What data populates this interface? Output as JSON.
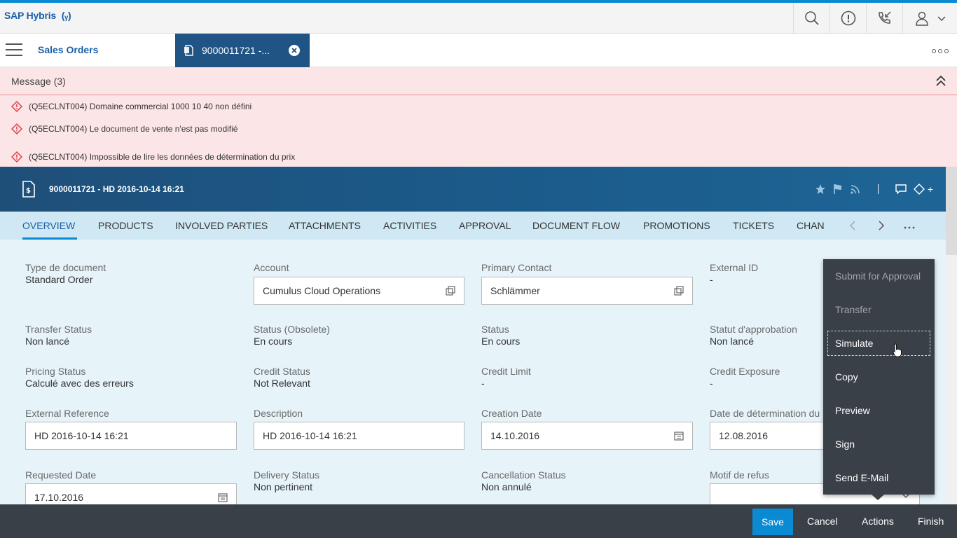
{
  "shell": {
    "logo_text": "SAP Hybris",
    "logo_mark": "(ᵧ)"
  },
  "tabs": {
    "sales_orders": "Sales Orders",
    "document_tab": "9000011721 -..."
  },
  "messages": {
    "header": "Message (3)",
    "items": [
      "(Q5ECLNT004) Domaine commercial 1000 10 40 non défini",
      "(Q5ECLNT004) Le document de vente n'est pas modifié",
      "(Q5ECLNT004) Impossible de lire les données de détermination du prix"
    ]
  },
  "object_header": {
    "title": "9000011721 - HD 2016-10-14 16:21",
    "plus": "+"
  },
  "subtabs": [
    "OVERVIEW",
    "PRODUCTS",
    "INVOLVED PARTIES",
    "ATTACHMENTS",
    "ACTIVITIES",
    "APPROVAL",
    "DOCUMENT FLOW",
    "PROMOTIONS",
    "TICKETS",
    "CHAN"
  ],
  "fields": {
    "type_document": {
      "label": "Type de document",
      "value": "Standard Order"
    },
    "account": {
      "label": "Account",
      "value": "Cumulus Cloud Operations"
    },
    "primary_contact": {
      "label": "Primary Contact",
      "value": "Schlämmer"
    },
    "external_id": {
      "label": "External ID",
      "value": "-"
    },
    "transfer_status": {
      "label": "Transfer Status",
      "value": "Non lancé"
    },
    "status_obsolete": {
      "label": "Status (Obsolete)",
      "value": "En cours"
    },
    "status": {
      "label": "Status",
      "value": "En cours"
    },
    "statut_approbation": {
      "label": "Statut d'approbation",
      "value": "Non lancé"
    },
    "pricing_status": {
      "label": "Pricing Status",
      "value": "Calculé avec des erreurs"
    },
    "credit_status": {
      "label": "Credit Status",
      "value": "Not Relevant"
    },
    "credit_limit": {
      "label": "Credit Limit",
      "value": "-"
    },
    "credit_exposure": {
      "label": "Credit Exposure",
      "value": "-"
    },
    "external_reference": {
      "label": "External Reference",
      "value": "HD 2016-10-14 16:21"
    },
    "description": {
      "label": "Description",
      "value": "HD 2016-10-14 16:21"
    },
    "creation_date": {
      "label": "Creation Date",
      "value": "14.10.2016"
    },
    "date_determination": {
      "label": "Date de détermination du",
      "value": "12.08.2016"
    },
    "requested_date": {
      "label": "Requested Date",
      "value": "17.10.2016"
    },
    "delivery_status": {
      "label": "Delivery Status",
      "value": "Non pertinent"
    },
    "cancellation_status": {
      "label": "Cancellation Status",
      "value": "Non annulé"
    },
    "motif_refus": {
      "label": "Motif de refus",
      "value": ""
    }
  },
  "actions_menu": [
    "Submit for Approval",
    "Transfer",
    "Simulate",
    "Copy",
    "Preview",
    "Sign",
    "Send E-Mail"
  ],
  "footer": {
    "save": "Save",
    "cancel": "Cancel",
    "actions": "Actions",
    "finish": "Finish"
  },
  "colors": {
    "accent": "#0a8ad2",
    "header_blue": "#1f5485",
    "error": "#e0373f"
  }
}
